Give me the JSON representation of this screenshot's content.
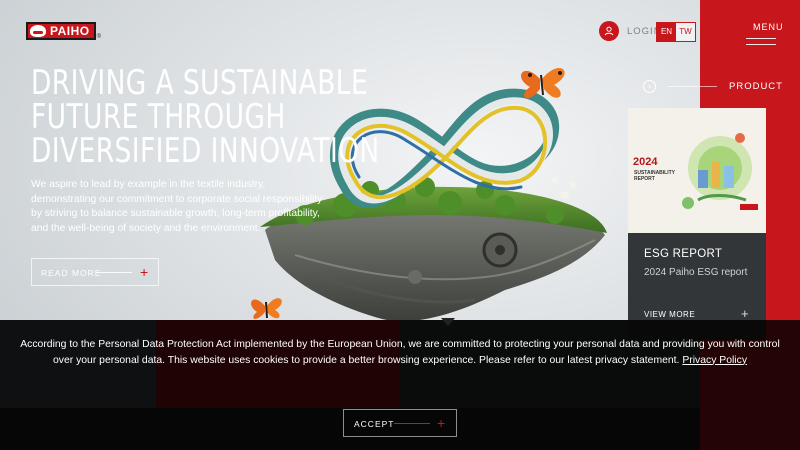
{
  "header": {
    "brand": "PAIHO",
    "login_label": "LOGIN",
    "languages": [
      {
        "code": "EN",
        "active": true
      },
      {
        "code": "TW",
        "active": false
      }
    ],
    "menu_label": "MENU"
  },
  "hero": {
    "title_lines": [
      "DRIVING A SUSTAINABLE",
      "FUTURE THROUGH",
      "DIVERSIFIED INNOVATION"
    ],
    "description": "We aspire to lead by example in the textile industry, demonstrating our commitment to corporate social responsibility by striving to balance sustainable growth, long-term profitability, and the well-being of society and the environment.",
    "read_more_label": "READ MORE"
  },
  "side_nav": {
    "product_label": "PRODUCT",
    "card": {
      "cover_year": "2024",
      "cover_line1": "SUSTAINABILITY",
      "cover_line2": "REPORT",
      "title": "ESG REPORT",
      "description": "2024 Paiho ESG report",
      "view_more_label": "VIEW MORE"
    }
  },
  "cookie_banner": {
    "text_line1": "According to the Personal Data Protection Act implemented by the European Union, we are committed to protecting your personal data and providing you with control",
    "text_line2": "over your personal data. This website uses cookies to provide a better browsing experience. Please refer to our latest privacy statement.",
    "privacy_link": "Privacy Policy",
    "accept_label": "ACCEPT"
  },
  "colors": {
    "brand_red": "#c8161d",
    "card_dark": "#333638"
  }
}
